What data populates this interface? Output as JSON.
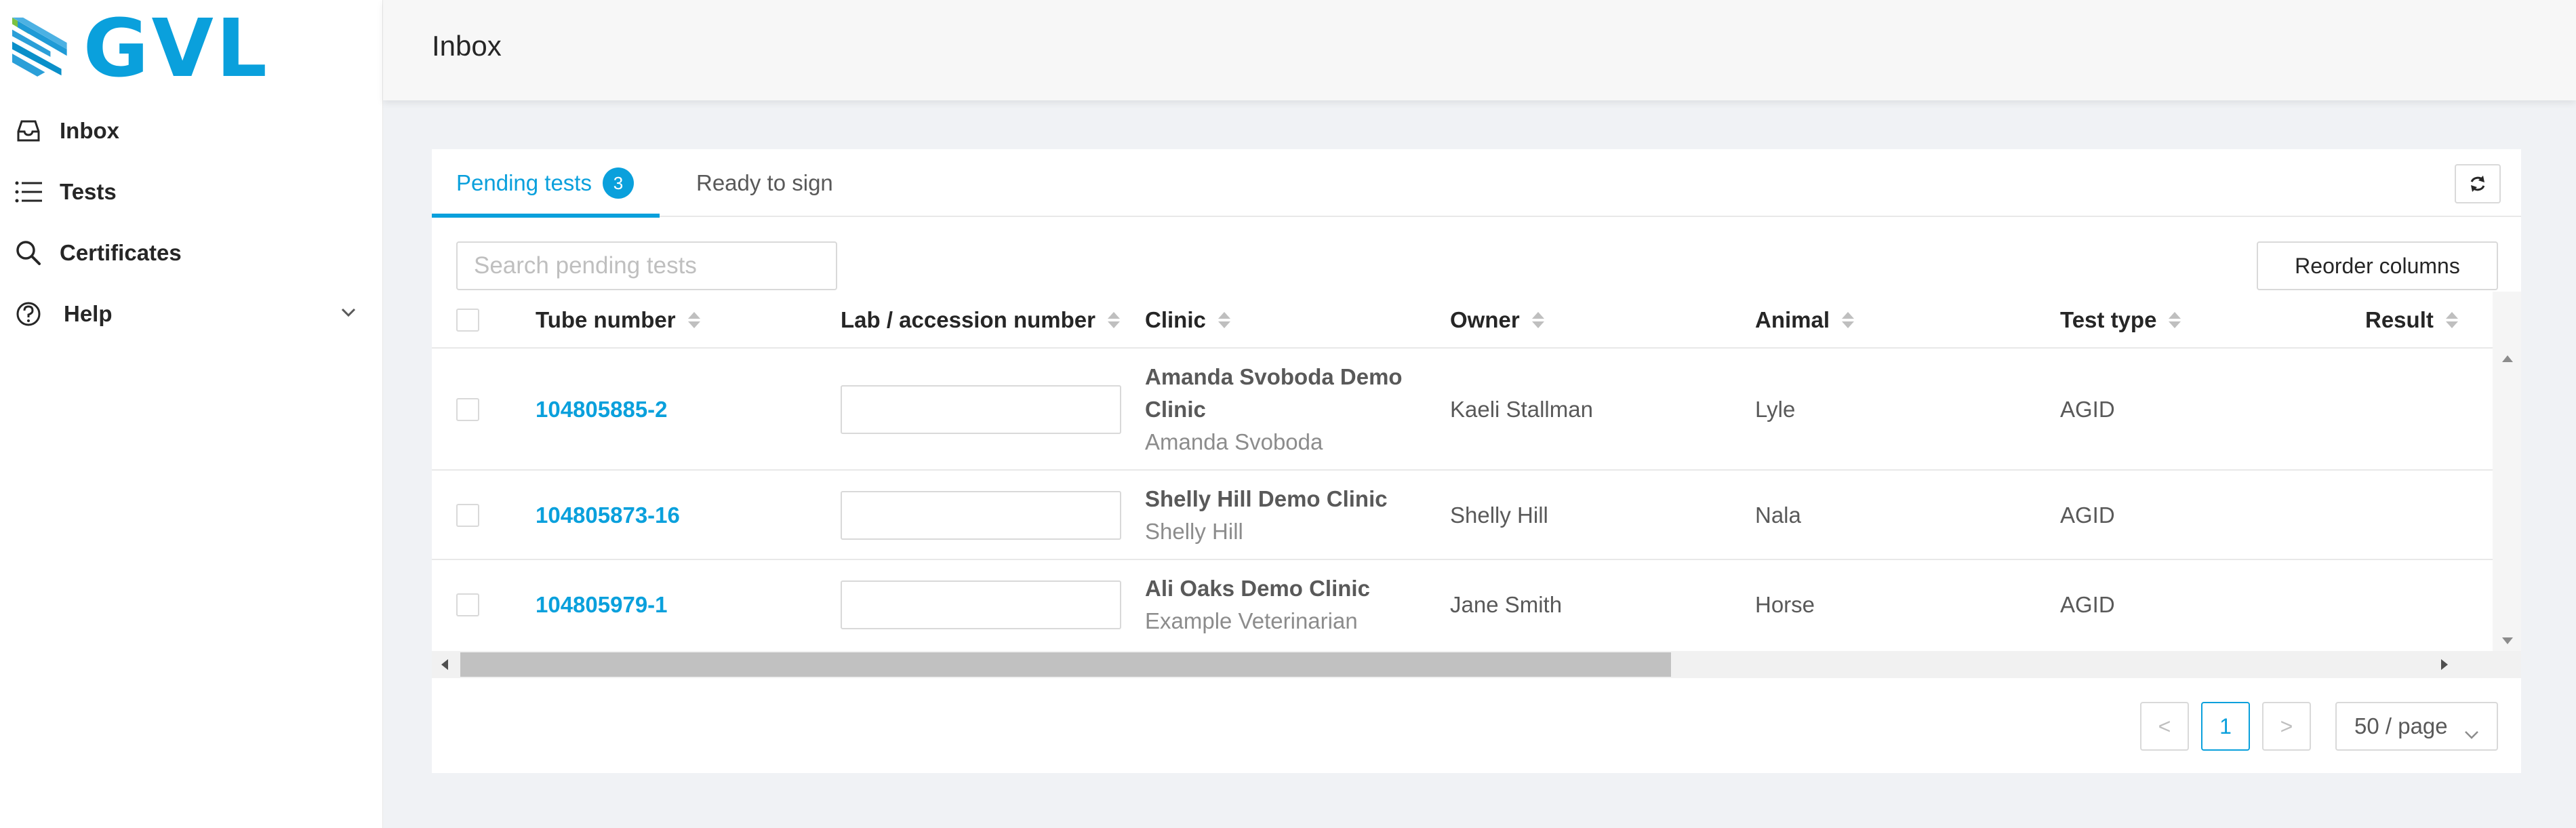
{
  "brand": {
    "name": "GVL",
    "accent": "#0aa0dc"
  },
  "sidebar": {
    "items": [
      {
        "label": "Inbox",
        "icon": "inbox-icon"
      },
      {
        "label": "Tests",
        "icon": "list-icon"
      },
      {
        "label": "Certificates",
        "icon": "search-icon"
      },
      {
        "label": "Help",
        "icon": "help-icon"
      }
    ]
  },
  "header": {
    "title": "Inbox"
  },
  "tabs": {
    "pending_label": "Pending tests",
    "pending_count": "3",
    "ready_label": "Ready to sign"
  },
  "toolbar": {
    "search_placeholder": "Search pending tests",
    "reorder_label": "Reorder columns"
  },
  "table": {
    "columns": [
      "Tube number",
      "Lab / accession number",
      "Clinic",
      "Owner",
      "Animal",
      "Test type",
      "Result"
    ],
    "rows": [
      {
        "tube": "104805885-2",
        "lab": "",
        "clinic": "Amanda Svoboda Demo Clinic",
        "clinic_sub": "Amanda Svoboda",
        "owner": "Kaeli Stallman",
        "animal": "Lyle",
        "test_type": "AGID",
        "result": ""
      },
      {
        "tube": "104805873-16",
        "lab": "",
        "clinic": "Shelly Hill Demo Clinic",
        "clinic_sub": "Shelly Hill",
        "owner": "Shelly Hill",
        "animal": "Nala",
        "test_type": "AGID",
        "result": ""
      },
      {
        "tube": "104805979-1",
        "lab": "",
        "clinic": "Ali Oaks Demo Clinic",
        "clinic_sub": "Example Veterinarian",
        "owner": "Jane Smith",
        "animal": "Horse",
        "test_type": "AGID",
        "result": ""
      }
    ]
  },
  "pagination": {
    "current_page": "1",
    "page_size": "50 / page",
    "prev": "<",
    "next": ">"
  }
}
